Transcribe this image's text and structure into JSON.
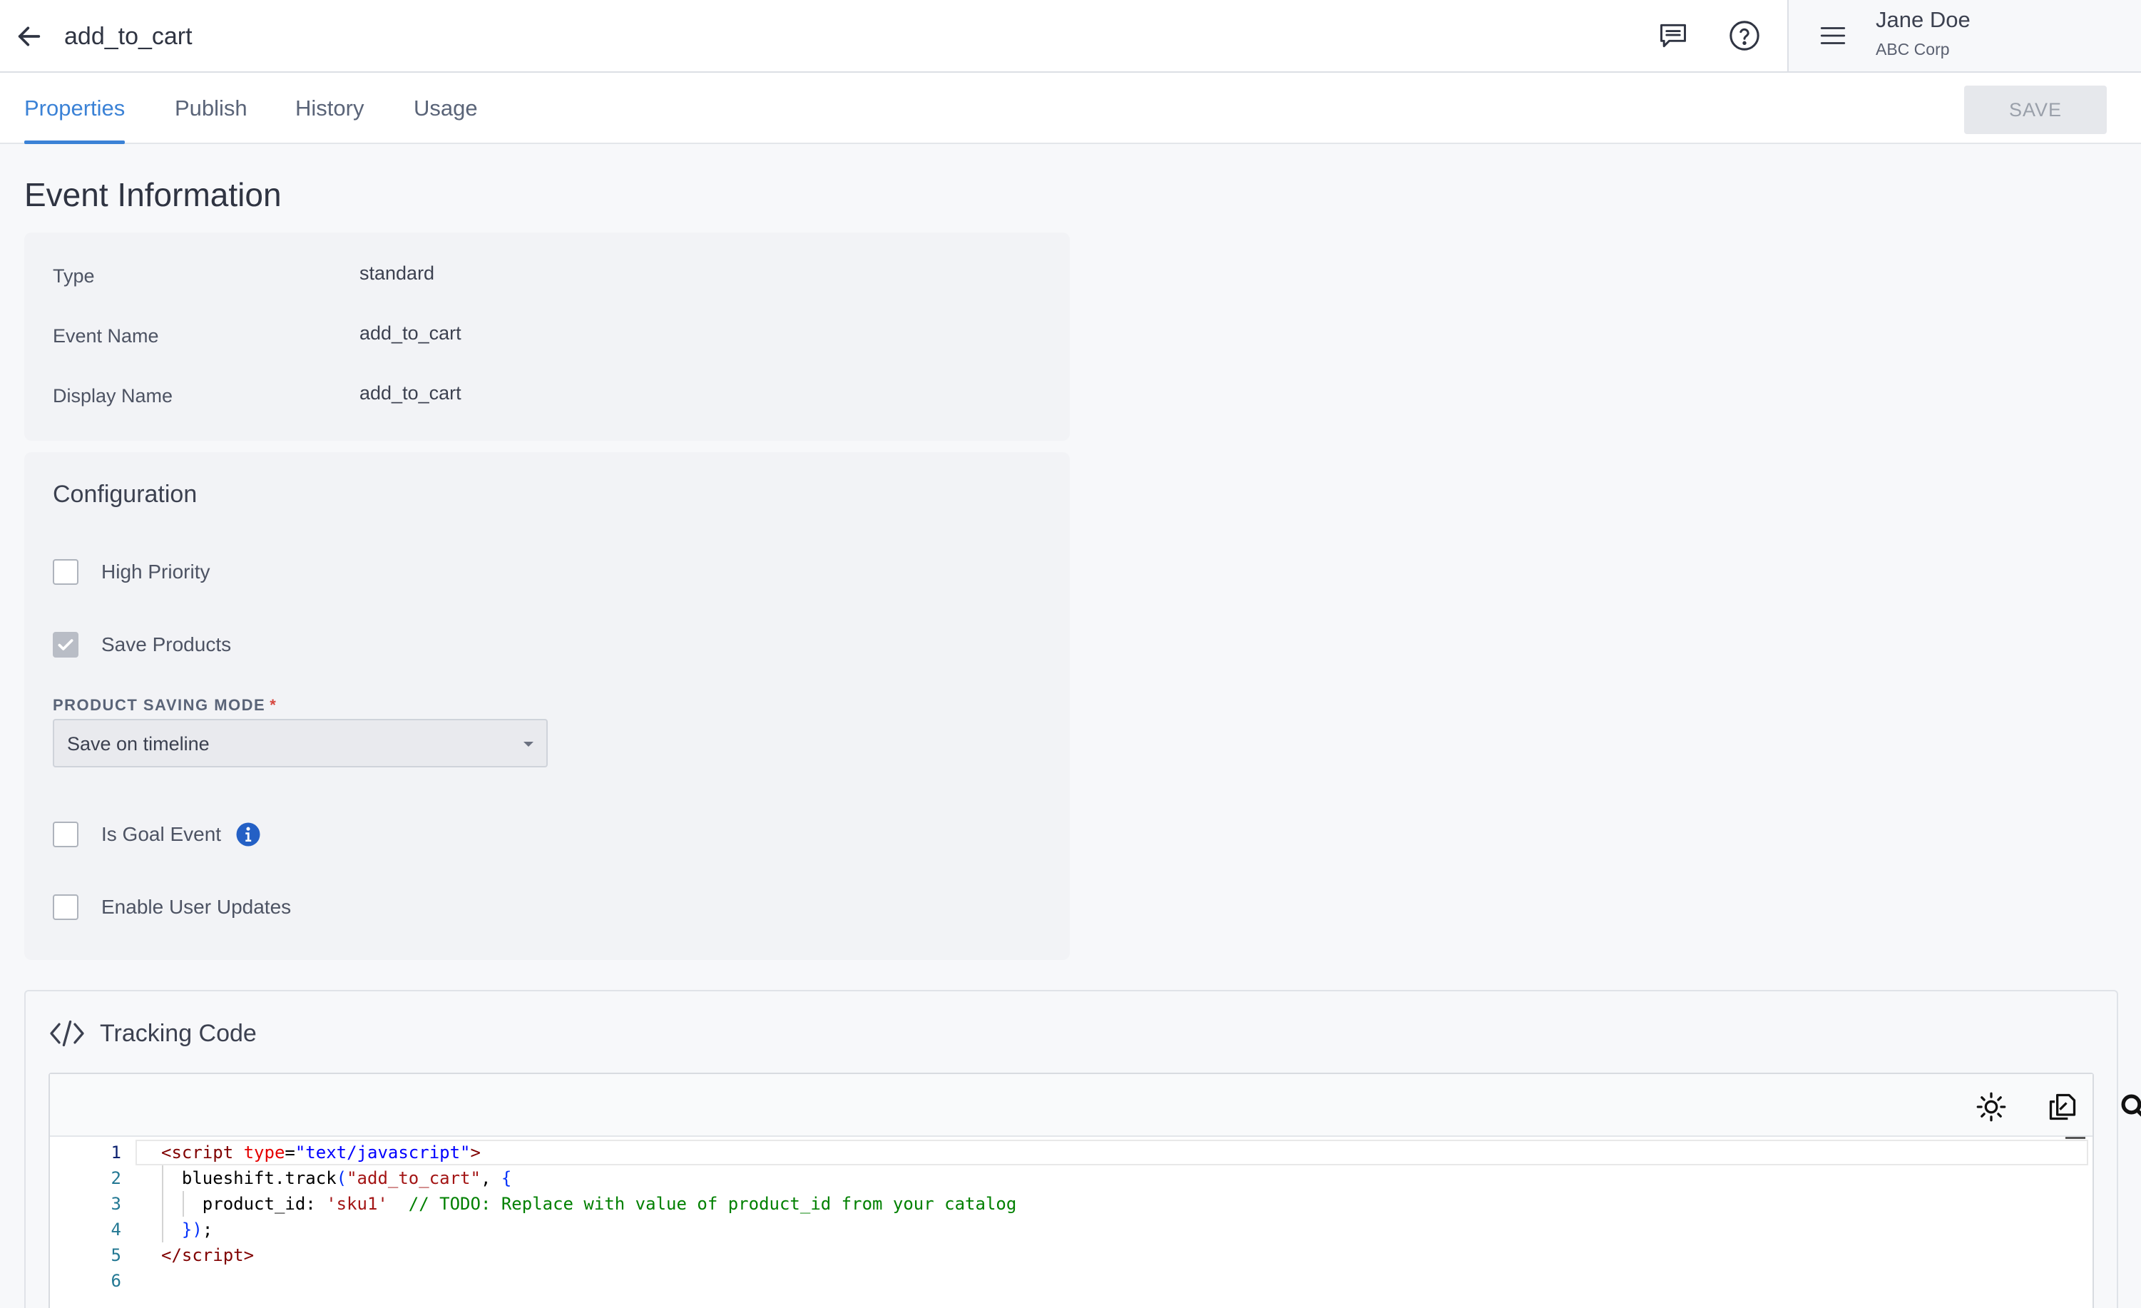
{
  "header": {
    "title": "add_to_cart",
    "user_name": "Jane Doe",
    "user_org": "ABC Corp",
    "icons": [
      "back-arrow-icon",
      "chat-icon",
      "help-icon",
      "hamburger-menu-icon"
    ]
  },
  "tabs": [
    {
      "label": "Properties",
      "active": true
    },
    {
      "label": "Publish",
      "active": false
    },
    {
      "label": "History",
      "active": false
    },
    {
      "label": "Usage",
      "active": false
    }
  ],
  "save_label": "SAVE",
  "event_info": {
    "title": "Event Information",
    "rows": [
      {
        "label": "Type",
        "value": "standard"
      },
      {
        "label": "Event Name",
        "value": "add_to_cart"
      },
      {
        "label": "Display Name",
        "value": "add_to_cart"
      }
    ]
  },
  "configuration": {
    "title": "Configuration",
    "high_priority": {
      "label": "High Priority",
      "checked": false
    },
    "save_products": {
      "label": "Save Products",
      "checked": true
    },
    "product_saving_mode": {
      "label": "PRODUCT SAVING MODE",
      "required_mark": "*",
      "value": "Save on timeline"
    },
    "is_goal_event": {
      "label": "Is Goal Event",
      "checked": false
    },
    "enable_user_updates": {
      "label": "Enable User Updates",
      "checked": false
    }
  },
  "tracking": {
    "title": "Tracking Code",
    "toolbar_icons": [
      "theme-toggle-icon",
      "copy-icon",
      "search-icon"
    ],
    "line_numbers": [
      "1",
      "2",
      "3",
      "4",
      "5",
      "6"
    ],
    "lines": [
      [
        {
          "t": "<",
          "c": "t-tag"
        },
        {
          "t": "script",
          "c": "t-tag"
        },
        {
          "t": " ",
          "c": ""
        },
        {
          "t": "type",
          "c": "t-attr"
        },
        {
          "t": "=",
          "c": ""
        },
        {
          "t": "\"text/javascript\"",
          "c": "t-str"
        },
        {
          "t": ">",
          "c": "t-tag"
        }
      ],
      [
        {
          "t": "  blueshift.track",
          "c": ""
        },
        {
          "t": "(",
          "c": "t-punc"
        },
        {
          "t": "\"add_to_cart\"",
          "c": "t-str2"
        },
        {
          "t": ", ",
          "c": ""
        },
        {
          "t": "{",
          "c": "t-punc"
        }
      ],
      [
        {
          "t": "    product_id: ",
          "c": ""
        },
        {
          "t": "'sku1'",
          "c": "t-str2"
        },
        {
          "t": "  ",
          "c": ""
        },
        {
          "t": "// TODO: Replace with value of product_id from your catalog",
          "c": "t-cmt"
        }
      ],
      [
        {
          "t": "  ",
          "c": ""
        },
        {
          "t": "})",
          "c": "t-punc"
        },
        {
          "t": ";",
          "c": ""
        }
      ],
      [
        {
          "t": "</",
          "c": "t-tag"
        },
        {
          "t": "script",
          "c": "t-tag"
        },
        {
          "t": ">",
          "c": "t-tag"
        }
      ],
      []
    ]
  }
}
